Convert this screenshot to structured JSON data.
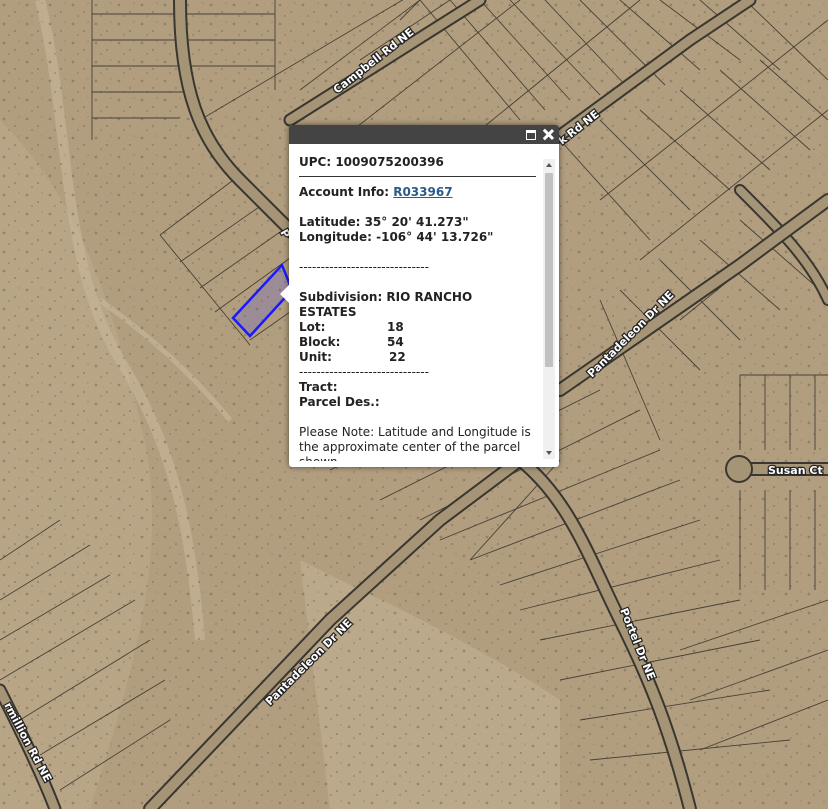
{
  "map": {
    "roads": {
      "campbell": "Campbell Rd NE",
      "k_rd": "k Rd NE",
      "pantadeleon_upper": "Pantadeleon Dr NE",
      "pantadeleon_lower": "Pantadeleon Dr NE",
      "susan": "Susan Ct",
      "portel": "Portel Dr NE",
      "vermillion": "rmillion Rd NE",
      "p_fragment": "P"
    },
    "parcel_highlight_color": "#1a1aff"
  },
  "popup": {
    "upc": "UPC: 1009075200396",
    "account_label": "Account Info:",
    "account_value": "R033967",
    "latitude": "Latitude: 35° 20' 41.273\"",
    "longitude": "Longitude: -106° 44' 13.726\"",
    "separator": "------------------------------",
    "subdivision_line1": "Subdivision: RIO RANCHO",
    "subdivision_line2": "ESTATES",
    "lot_label": "Lot:",
    "lot_value": "18",
    "block_label": "Block:",
    "block_value": "54",
    "unit_label": "Unit:",
    "unit_value": "22",
    "tract_label": "Tract:",
    "parcel_des_label": "Parcel Des.:",
    "note": "Please Note: Latitude and Longitude is the approximate center of the parcel shown."
  }
}
